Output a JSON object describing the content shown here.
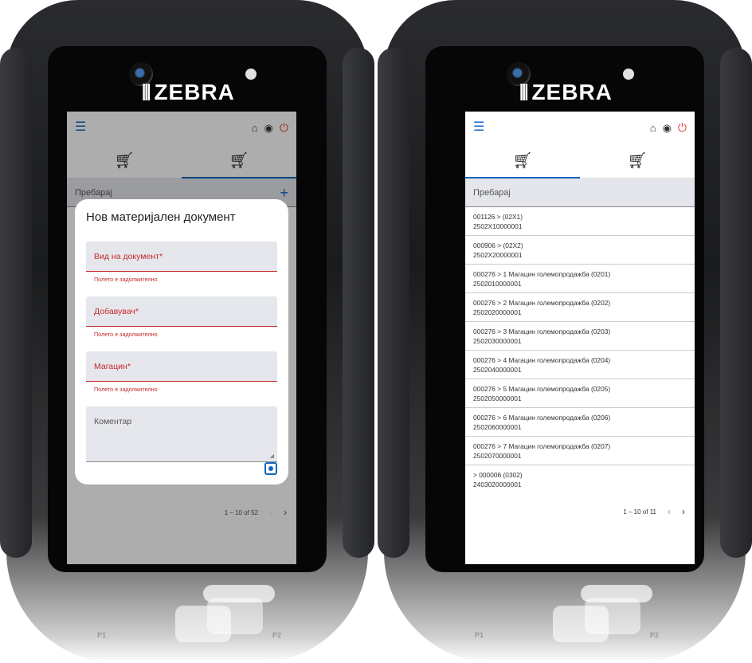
{
  "brand": {
    "name": "ZEBRA"
  },
  "keypad": {
    "p1": "P1",
    "p2": "P2"
  },
  "left_screen": {
    "search_label": "Пребарај",
    "dialog": {
      "title": "Нов материјален документ",
      "fields": [
        {
          "label": "Вид на документ*",
          "error": "Полето е задолжително"
        },
        {
          "label": "Добавувач*",
          "error": "Полето е задолжително"
        },
        {
          "label": "Магацин*",
          "error": "Полето е задолжително"
        }
      ],
      "comment_label": "Коментар"
    },
    "paginator": {
      "range": "1 – 10 of 52"
    }
  },
  "right_screen": {
    "search_label": "Пребарај",
    "items": [
      {
        "line1": "001126 >  (02X1)",
        "line2": "2502X10000001"
      },
      {
        "line1": "000906 >  (02X2)",
        "line2": "2502X20000001"
      },
      {
        "line1": "000276 > 1 Магацин големопродажба (0201)",
        "line2": "2502010000001"
      },
      {
        "line1": "000276 > 2 Магацин големопродажба (0202)",
        "line2": "2502020000001"
      },
      {
        "line1": "000276 > 3 Магацин големопродажба (0203)",
        "line2": "2502030000001"
      },
      {
        "line1": "000276 > 4 Магацин големопродажба (0204)",
        "line2": "2502040000001"
      },
      {
        "line1": "000276 > 5 Магацин големопродажба (0205)",
        "line2": "2502050000001"
      },
      {
        "line1": "000276 > 6 Магацин големопродажба (0206)",
        "line2": "2502060000001"
      },
      {
        "line1": "000276 > 7 Магацин големопродажба (0207)",
        "line2": "2502070000001"
      },
      {
        "line1": " > 000006 (0302)",
        "line2": "2403020000001"
      }
    ],
    "paginator": {
      "range": "1 – 10 of 11"
    }
  },
  "icons": {
    "menu": "hamburger-icon",
    "home": "home-icon",
    "account": "account-circle-icon",
    "power": "power-icon",
    "cart": "cart-icon",
    "cart_add": "cart-add-icon",
    "plus": "plus-icon",
    "save": "save-icon",
    "prev": "chevron-left-icon",
    "next": "chevron-right-icon"
  },
  "colors": {
    "accent": "#1565c0",
    "error": "#c62828",
    "power": "#e53935"
  }
}
